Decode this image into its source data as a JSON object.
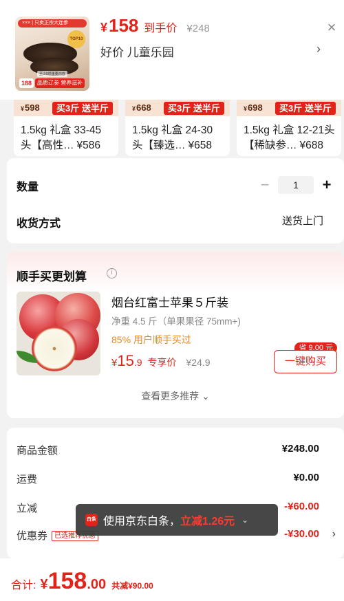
{
  "header": {
    "image_banner": "××× | 只卖正宗大连参",
    "image_top10": "TOP10",
    "image_tagline": "至少5项重要内容",
    "image_price": "188",
    "image_badge": "品质辽参 营养滋补",
    "currency": "¥",
    "price": "158",
    "price_tag": "到手价",
    "original_price": "¥248",
    "promo_line": "好价 儿童乐园",
    "close_label": "×",
    "chevron": "›"
  },
  "options": [
    {
      "price": "598",
      "promo": "买3斤 送半斤",
      "line1": "1.5kg 礼盒 33-45",
      "line2_name": "头【高性…",
      "line2_price": "¥586"
    },
    {
      "price": "668",
      "promo": "买3斤 送半斤",
      "line1": "1.5kg 礼盒 24-30",
      "line2_name": "头【臻选…",
      "line2_price": "¥658"
    },
    {
      "price": "698",
      "promo": "买3斤 送半斤",
      "line1": "1.5kg 礼盒 12-21头",
      "line2_name": "【稀缺参…",
      "line2_price": "¥688"
    }
  ],
  "quantity": {
    "label": "数量",
    "value": "1",
    "minus": "−",
    "plus": "+"
  },
  "delivery": {
    "label": "收货方式",
    "value": "送货上门"
  },
  "recommend": {
    "title": "顺手买更划算",
    "info_icon": "i",
    "name": "烟台红富士苹果５斤装",
    "subtitle": "净重 4.5 斤（单果果径 75mm+)",
    "note": "85% 用户顺手买过",
    "price_yen": "¥",
    "price_int": "15",
    "price_dec": ".9",
    "price_tag": "专享价",
    "original": "¥24.9",
    "save_badge": "省 9.00 元",
    "buy_label": "一键购买",
    "more_label": "查看更多推荐 ⌄"
  },
  "summary": {
    "items": [
      {
        "label": "商品金额",
        "value": "¥248.00"
      },
      {
        "label": "运费",
        "value": "¥0.00"
      },
      {
        "label": "立减",
        "value": "-¥60.00"
      },
      {
        "label": "优惠券",
        "value": "-¥30.00",
        "tag": "已选推荐优惠"
      }
    ],
    "chevron": "›"
  },
  "toast": {
    "icon_text": "白条",
    "message": "使用京东白条，",
    "highlight": "立减1.26元",
    "chevron": "⌄"
  },
  "bottom": {
    "total_label": "合计:",
    "yen": "¥",
    "total_int": "158",
    "total_dec": ".00",
    "saved": "共减¥90.00"
  },
  "colors": {
    "accent": "#e2231a",
    "orange": "#e58a22"
  }
}
